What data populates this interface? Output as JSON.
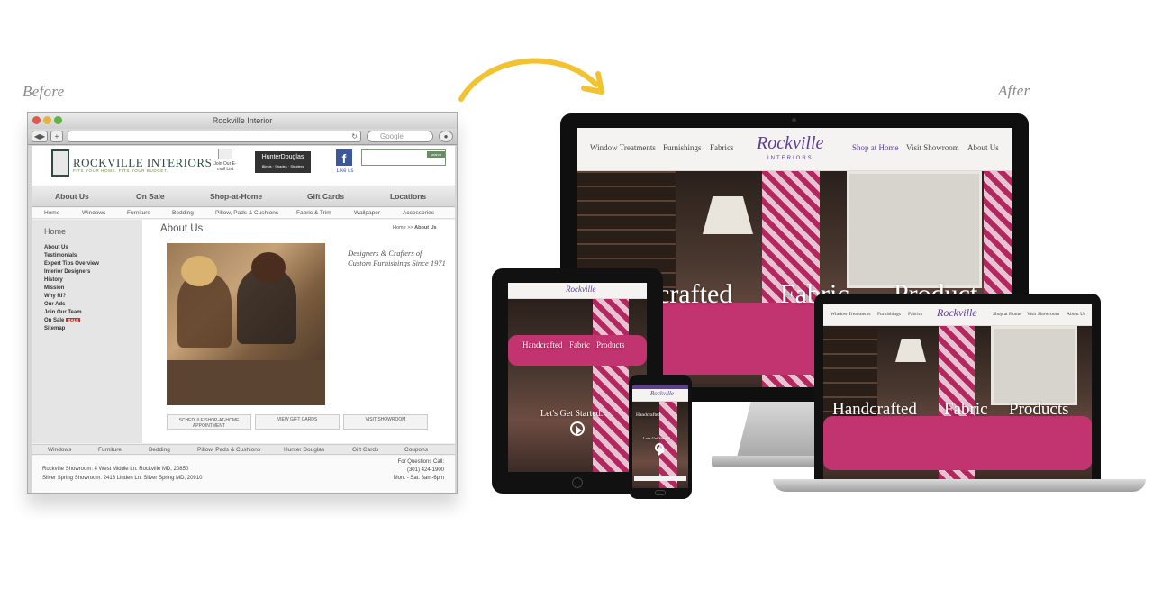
{
  "labels": {
    "before": "Before",
    "after": "After"
  },
  "before": {
    "window_title": "Rockville Interior",
    "search_placeholder": "Google",
    "logo_text": "ROCKVILLE INTERIORS",
    "logo_tagline": "FITS YOUR HOME. FITS YOUR BUDGET.",
    "mailing_list": "Join Our E-mail List",
    "hd_text": "HunterDouglas",
    "hd_sub": "Blinds · Shades · Shutters",
    "facebook_label": "Like us",
    "search_button": "search",
    "main_nav": [
      "About Us",
      "On Sale",
      "Shop-at-Home",
      "Gift Cards",
      "Locations"
    ],
    "sub_nav": [
      "Home",
      "Windows",
      "Furniture",
      "Bedding",
      "Pillow, Pads & Cushions",
      "Fabric & Trim",
      "Wallpaper",
      "Accessories"
    ],
    "sidebar": {
      "heading": "Home",
      "items": [
        "About Us",
        "Testimonials",
        "Expert Tips Overview",
        "Interior Designers",
        "History",
        "Mission",
        "Why RI?",
        "Our Ads",
        "Join Our Team",
        "On Sale",
        "Sitemap"
      ],
      "sale_badge": "SALE"
    },
    "content": {
      "title": "About Us",
      "breadcrumb_home": "Home >> ",
      "breadcrumb_current": "About Us",
      "tagline": "Designers & Crafters of Custom Furnishings Since 1971",
      "buttons": [
        "SCHEDULE SHOP-AT-HOME APPOINTMENT",
        "VIEW GIFT CARDS",
        "VISIT SHOWROOM"
      ]
    },
    "bottom_nav": [
      "Windows",
      "Furniture",
      "Bedding",
      "Pillow, Pads & Cushions",
      "Hunter Douglas",
      "Gift Cards",
      "Coupons"
    ],
    "footer": {
      "address1": "Rockville Showroom: 4 West Middle Ln. Rockville MD, 20850",
      "address2": "Silver Spring Showroom: 2418 Linden Ln. Silver Spring MD, 20910",
      "call_label": "For Questions Call:",
      "phone": "(301) 424-1900",
      "hours": "Mon. - Sat. 8am-6pm"
    }
  },
  "after": {
    "nav_left": [
      "Window Treatments",
      "Furnishings",
      "Fabrics"
    ],
    "nav_right": [
      "Shop at Home",
      "Visit Showroom",
      "About Us"
    ],
    "logo": "Rockville",
    "logo_sub": "INTERIORS",
    "hero_words": [
      "Handcrafted",
      "Fabric",
      "Products"
    ],
    "imac_hero_words": [
      "crafted",
      "Fabric",
      "Product"
    ],
    "cta": "Let's Get Started...",
    "accent_color": "#5e3f8f",
    "arrow_color": "#f2c230"
  }
}
